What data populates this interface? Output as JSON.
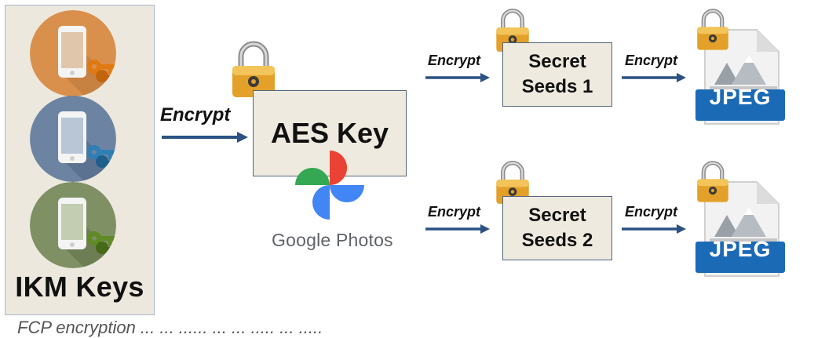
{
  "ikm": {
    "label": "IKM Keys",
    "devices": [
      {
        "color": "#d9904c",
        "key_color": "#e07a10"
      },
      {
        "color": "#6c84a1",
        "key_color": "#2e7fb5"
      },
      {
        "color": "#7e9064",
        "key_color": "#5f8a24"
      }
    ]
  },
  "aes": {
    "label": "AES Key",
    "service": "Google Photos"
  },
  "arrows": {
    "main_label": "Encrypt",
    "seed_label": "Encrypt",
    "jpeg_label": "Encrypt"
  },
  "seeds": [
    {
      "line1": "Secret",
      "line2": "Seeds 1"
    },
    {
      "line1": "Secret",
      "line2": "Seeds 2"
    }
  ],
  "files": [
    {
      "label": "JPEG"
    },
    {
      "label": "JPEG"
    }
  ],
  "colors": {
    "arrow": "#2b5283",
    "lock_gold": "#e3a12a",
    "jpeg_blue": "#1b6ab5"
  },
  "footer": "FCP encryption ... ... ...... ... ... ..... ... ....."
}
